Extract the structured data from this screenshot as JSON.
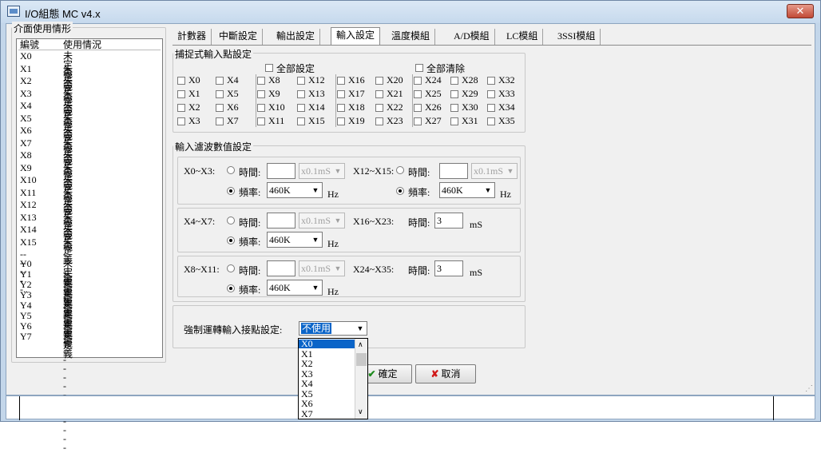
{
  "window": {
    "title": "I/O組態 MC v4.x",
    "close_glyph": "✕"
  },
  "usage": {
    "group_label": "介面使用情形",
    "col_id": "編號",
    "col_status": "使用情況",
    "x_rows": [
      [
        "X0",
        "未定義"
      ],
      [
        "X1",
        "未定義"
      ],
      [
        "X2",
        "未定義"
      ],
      [
        "X3",
        "未定義"
      ],
      [
        "X4",
        "未定義"
      ],
      [
        "X5",
        "未定義"
      ],
      [
        "X6",
        "未定義"
      ],
      [
        "X7",
        "未定義"
      ],
      [
        "X8",
        "未定義"
      ],
      [
        "X9",
        "未定義"
      ],
      [
        "X10",
        "未定義"
      ],
      [
        "X11",
        "未定義"
      ],
      [
        "X12",
        "未定義"
      ],
      [
        "X13",
        "未定義"
      ],
      [
        "X14",
        "未定義"
      ],
      [
        "X15",
        "未定義"
      ]
    ],
    "separator_id": "--------..",
    "separator_status": "-----------------------",
    "y_rows": [
      [
        "Y0",
        "未定義"
      ],
      [
        "Y1",
        "未定義"
      ],
      [
        "Y2",
        "未定義"
      ],
      [
        "Y3",
        "未定義"
      ],
      [
        "Y4",
        "未定義"
      ],
      [
        "Y5",
        "未定義"
      ],
      [
        "Y6",
        "未定義"
      ],
      [
        "Y7",
        "未定義"
      ]
    ]
  },
  "tabs": [
    "計數器",
    "中斷設定",
    "輸出設定",
    "輸入設定",
    "溫度模組",
    "A/D模組",
    "LC模組",
    "3SSI模組"
  ],
  "active_tab": "輸入設定",
  "capture": {
    "group_label": "捕捉式輸入點設定",
    "set_all": "全部設定",
    "clear_all": "全部清除",
    "points": [
      [
        "X0",
        "X1",
        "X2",
        "X3"
      ],
      [
        "X4",
        "X5",
        "X6",
        "X7"
      ],
      [
        "X8",
        "X9",
        "X10",
        "X11"
      ],
      [
        "X12",
        "X13",
        "X14",
        "X15"
      ],
      [
        "X16",
        "X17",
        "X18",
        "X19"
      ],
      [
        "X20",
        "X21",
        "X22",
        "X23"
      ],
      [
        "X24",
        "X25",
        "X26",
        "X27"
      ],
      [
        "X28",
        "X29",
        "X30",
        "X31"
      ],
      [
        "X32",
        "X33",
        "X34",
        "X35"
      ]
    ]
  },
  "filter": {
    "group_label": "輸入濾波數值設定",
    "time_label": "時間:",
    "freq_label": "頻率:",
    "unit_placeholder": "x0.1mS",
    "freq_value": "460K",
    "hz": "Hz",
    "ms": "mS",
    "g1": {
      "a": "X0~X3:",
      "b": "X12~X15:"
    },
    "g2": {
      "a": "X4~X7:",
      "b": "X16~X23:",
      "b_value": "3"
    },
    "g3": {
      "a": "X8~X11:",
      "b": "X24~X35:",
      "b_value": "3"
    }
  },
  "force": {
    "label": "強制運轉輸入接點設定:",
    "value": "不使用",
    "options": [
      "X0",
      "X1",
      "X2",
      "X3",
      "X4",
      "X5",
      "X6",
      "X7"
    ]
  },
  "buttons": {
    "ok": "確定",
    "cancel": "取消"
  }
}
